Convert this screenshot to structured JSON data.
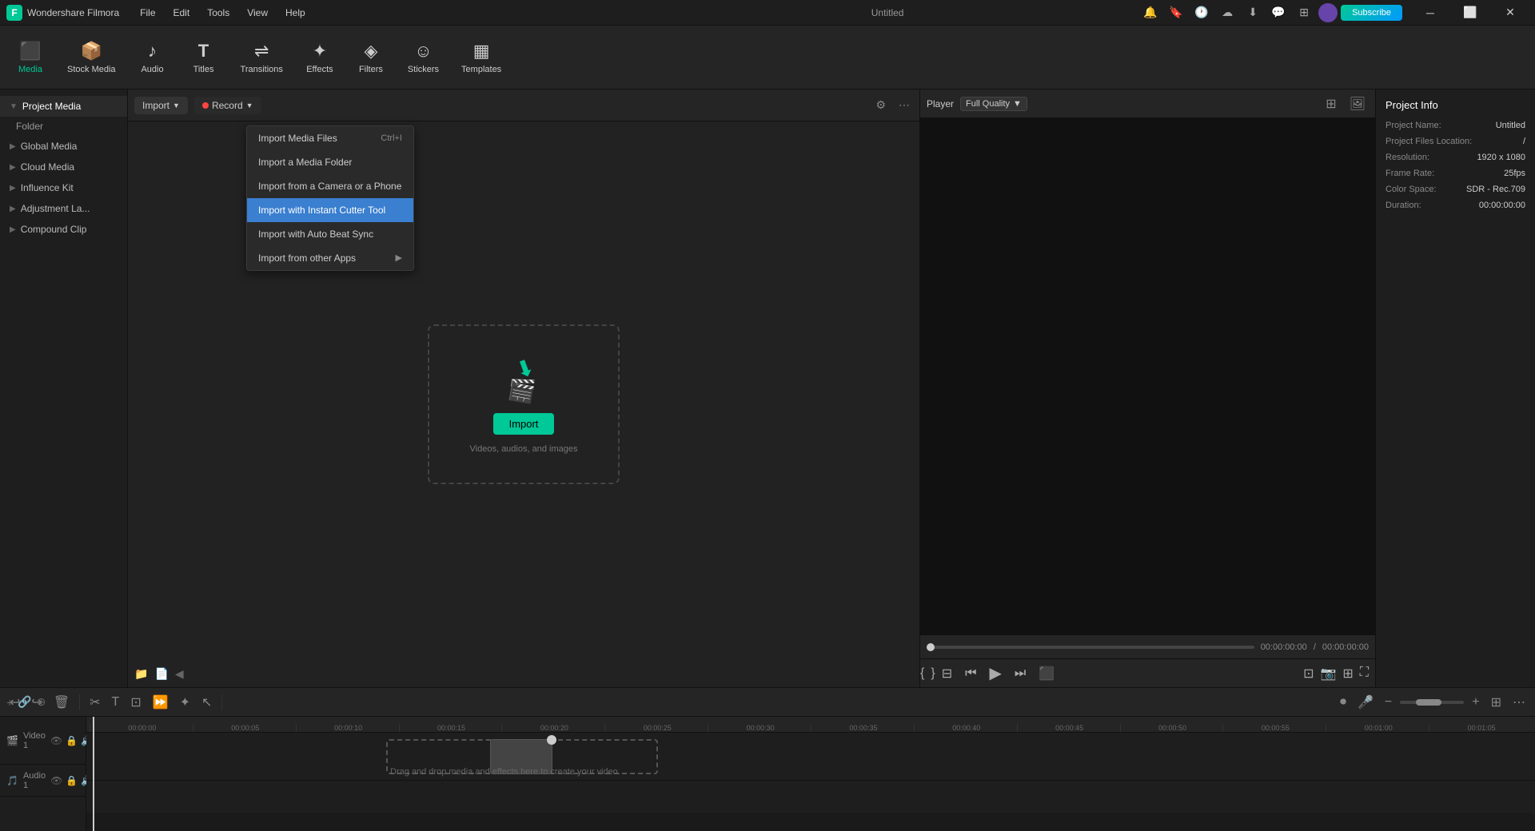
{
  "app": {
    "name": "Wondershare Filmora",
    "window_title": "Untitled"
  },
  "menu": {
    "items": [
      "File",
      "Edit",
      "Tools",
      "View",
      "Help"
    ]
  },
  "toolbar": {
    "items": [
      {
        "id": "media",
        "icon": "⬛",
        "label": "Media",
        "active": true
      },
      {
        "id": "stock",
        "icon": "📦",
        "label": "Stock Media"
      },
      {
        "id": "audio",
        "icon": "♪",
        "label": "Audio"
      },
      {
        "id": "titles",
        "icon": "T",
        "label": "Titles"
      },
      {
        "id": "transitions",
        "icon": "⇌",
        "label": "Transitions"
      },
      {
        "id": "effects",
        "icon": "✦",
        "label": "Effects"
      },
      {
        "id": "filters",
        "icon": "◈",
        "label": "Filters"
      },
      {
        "id": "stickers",
        "icon": "☺",
        "label": "Stickers"
      },
      {
        "id": "templates",
        "icon": "▦",
        "label": "Templates"
      }
    ]
  },
  "sidebar": {
    "sections": [
      {
        "id": "project-media",
        "label": "Project Media",
        "active": true,
        "has_sub": true
      },
      {
        "id": "folder",
        "label": "Folder",
        "sub": true
      },
      {
        "id": "global-media",
        "label": "Global Media"
      },
      {
        "id": "cloud-media",
        "label": "Cloud Media"
      },
      {
        "id": "influence-kit",
        "label": "Influence Kit"
      },
      {
        "id": "adjustment-layer",
        "label": "Adjustment La..."
      },
      {
        "id": "compound-clip",
        "label": "Compound Clip"
      }
    ]
  },
  "media_panel": {
    "import_btn": "Import",
    "record_btn": "Record",
    "drop_zone_text": "Videos, audios, and images",
    "import_btn_label": "Import"
  },
  "import_dropdown": {
    "items": [
      {
        "id": "import-media-files",
        "label": "Import Media Files",
        "shortcut": "Ctrl+I",
        "highlighted": false
      },
      {
        "id": "import-media-folder",
        "label": "Import a Media Folder",
        "shortcut": "",
        "highlighted": false
      },
      {
        "id": "import-from-camera",
        "label": "Import from a Camera or a Phone",
        "shortcut": "",
        "highlighted": false
      },
      {
        "id": "import-instant-cutter",
        "label": "Import with Instant Cutter Tool",
        "shortcut": "",
        "highlighted": true
      },
      {
        "id": "import-auto-beat-sync",
        "label": "Import with Auto Beat Sync",
        "shortcut": "",
        "highlighted": false
      },
      {
        "id": "import-other-apps",
        "label": "Import from other Apps",
        "shortcut": "",
        "has_arrow": true,
        "highlighted": false
      }
    ]
  },
  "player": {
    "label": "Player",
    "quality": "Full Quality",
    "current_time": "00:00:00:00",
    "total_time": "00:00:00:00"
  },
  "project_info": {
    "title": "Project Info",
    "name_label": "Project Name:",
    "name_value": "Untitled",
    "files_label": "Project Files Location:",
    "files_value": "/",
    "resolution_label": "Resolution:",
    "resolution_value": "1920 x 1080",
    "frame_rate_label": "Frame Rate:",
    "frame_rate_value": "25fps",
    "color_space_label": "Color Space:",
    "color_space_value": "SDR - Rec.709",
    "duration_label": "Duration:",
    "duration_value": "00:00:00:00"
  },
  "timeline": {
    "ruler_marks": [
      "00:00:00",
      "00:00:05",
      "00:00:10",
      "00:00:15",
      "00:00:20",
      "00:00:25",
      "00:00:30",
      "00:00:35",
      "00:00:40",
      "00:00:45",
      "00:00:50",
      "00:00:55",
      "00:01:00",
      "00:01:05"
    ],
    "tracks": [
      {
        "id": "video-1",
        "label": "Video 1",
        "type": "video"
      },
      {
        "id": "audio-1",
        "label": "Audio 1",
        "type": "audio"
      }
    ],
    "drag_text": "Drag and drop media and effects here to create your video."
  }
}
